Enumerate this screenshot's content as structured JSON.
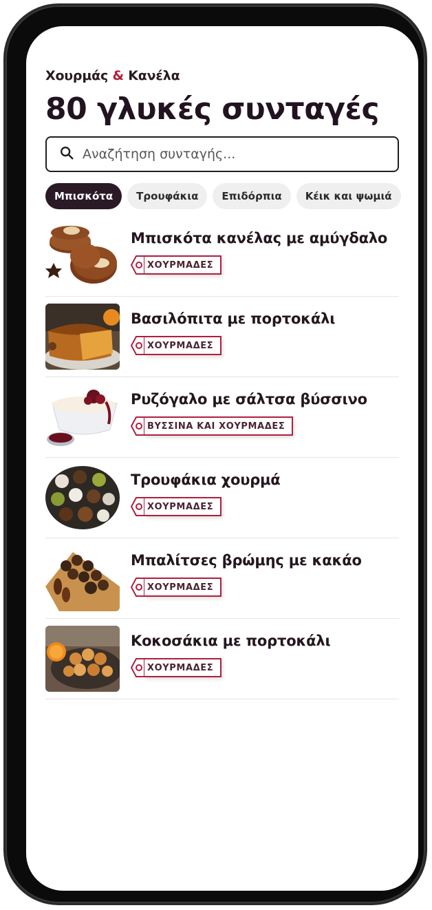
{
  "brand": {
    "name_part1": "Χουρμάς",
    "amp": "&",
    "name_part2": "Κανέλα"
  },
  "page_title": "80 γλυκές συνταγές",
  "search": {
    "placeholder": "Αναζήτηση συνταγής..."
  },
  "filters": [
    {
      "label": "Μπισκότα",
      "active": true
    },
    {
      "label": "Τρουφάκια",
      "active": false
    },
    {
      "label": "Επιδόρπια",
      "active": false
    },
    {
      "label": "Κέικ και ψωμιά",
      "active": false
    }
  ],
  "recipes": [
    {
      "title": "Μπισκότα κανέλας με αμύγδαλο",
      "tag": "ΧΟΥΡΜΑΔΕΣ",
      "image": "cinnamon-almond-cookies"
    },
    {
      "title": "Βασιλόπιτα με πορτοκάλι",
      "tag": "ΧΟΥΡΜΑΔΕΣ",
      "image": "orange-vasilopita"
    },
    {
      "title": "Ρυζόγαλο με σάλτσα βύσσινο",
      "tag": "ΒΥΣΣΙΝΑ ΚΑΙ ΧΟΥΡΜΑΔΕΣ",
      "image": "rice-pudding-cherry"
    },
    {
      "title": "Τρουφάκια χουρμά",
      "tag": "ΧΟΥΡΜΑΔΕΣ",
      "image": "date-truffles"
    },
    {
      "title": "Μπαλίτσες βρώμης με κακάο",
      "tag": "ΧΟΥΡΜΑΔΕΣ",
      "image": "oat-cocoa-balls"
    },
    {
      "title": "Κοκοσάκια με πορτοκάλι",
      "tag": "ΧΟΥΡΜΑΔΕΣ",
      "image": "orange-coconut-macaroons"
    }
  ],
  "colors": {
    "accent": "#b01e3e",
    "chip_active_bg": "#2b1a26",
    "chip_bg": "#efefef"
  }
}
